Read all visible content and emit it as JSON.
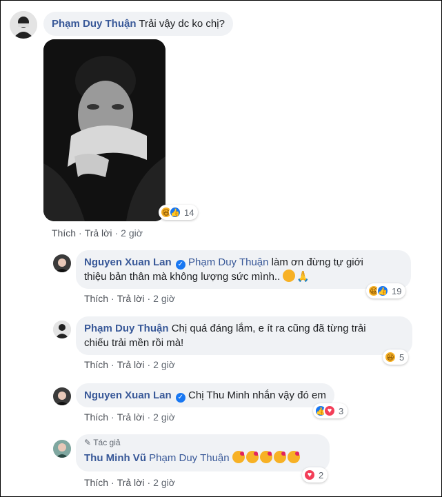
{
  "comments": [
    {
      "author": "Phạm Duy Thuận",
      "text": "Trải vậy dc ko chị?",
      "reaction_count": "14",
      "actions": {
        "like": "Thích",
        "reply": "Trả lời",
        "time": "2 giờ"
      }
    },
    {
      "author": "Nguyen Xuan Lan",
      "mention": "Phạm Duy Thuận",
      "line1": "làm ơn đừng tự giới",
      "line2": "thiệu bản thân mà không lượng sức mình..",
      "reaction_count": "19",
      "actions": {
        "like": "Thích",
        "reply": "Trả lời",
        "time": "2 giờ"
      }
    },
    {
      "author": "Phạm Duy Thuận",
      "line1": "Chị quá đáng lắm, e ít ra cũng đã từng trải",
      "line2": "chiếu trải mền rồi mà!",
      "reaction_count": "5",
      "actions": {
        "like": "Thích",
        "reply": "Trả lời",
        "time": "2 giờ"
      }
    },
    {
      "author": "Nguyen Xuan Lan",
      "text": "Chị Thu Minh nhắn vậy đó em",
      "reaction_count": "3",
      "actions": {
        "like": "Thích",
        "reply": "Trả lời",
        "time": "2 giờ"
      }
    },
    {
      "author_tag": "Tác giả",
      "author": "Thu Minh Vũ",
      "mention": "Phạm Duy Thuận",
      "reaction_count": "2",
      "actions": {
        "like": "Thích",
        "reply": "Trả lời",
        "time": "2 giờ"
      }
    }
  ],
  "colors": {
    "link": "#385898",
    "bubble": "#f0f2f5",
    "like": "#1877f2",
    "love": "#f33e58",
    "haha": "#f7b125"
  }
}
